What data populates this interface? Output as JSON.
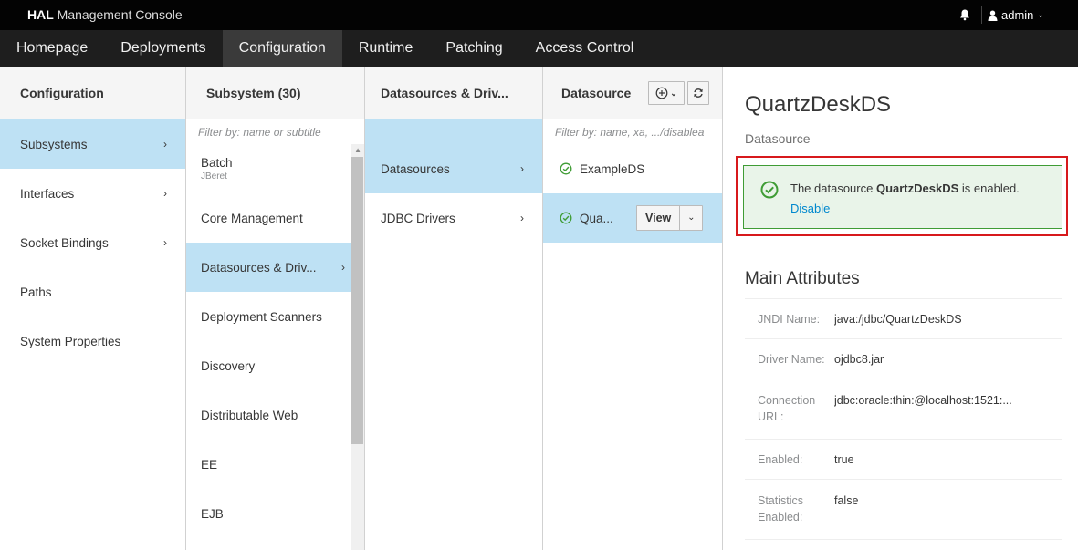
{
  "topbar": {
    "brand_bold": "HAL",
    "brand_rest": "Management Console",
    "user": "admin"
  },
  "nav": {
    "items": [
      "Homepage",
      "Deployments",
      "Configuration",
      "Runtime",
      "Patching",
      "Access Control"
    ],
    "active": "Configuration"
  },
  "columns": {
    "configuration": {
      "title": "Configuration",
      "items": [
        "Subsystems",
        "Interfaces",
        "Socket Bindings",
        "Paths",
        "System Properties"
      ]
    },
    "subsystem": {
      "title": "Subsystem (30)",
      "filter_placeholder": "Filter by: name or subtitle",
      "items": [
        {
          "label": "Batch",
          "sub": "JBeret"
        },
        {
          "label": "Core Management",
          "sub": ""
        },
        {
          "label": "Datasources & Driv...",
          "sub": ""
        },
        {
          "label": "Deployment Scanners",
          "sub": ""
        },
        {
          "label": "Discovery",
          "sub": ""
        },
        {
          "label": "Distributable Web",
          "sub": ""
        },
        {
          "label": "EE",
          "sub": ""
        },
        {
          "label": "EJB",
          "sub": ""
        }
      ]
    },
    "datasources_drivers": {
      "title": "Datasources & Driv...",
      "items": [
        "Datasources",
        "JDBC Drivers"
      ]
    },
    "datasource": {
      "title": "Datasource",
      "filter_placeholder": "Filter by: name, xa, .../disablea",
      "items": [
        "ExampleDS",
        "Qua..."
      ],
      "view_label": "View"
    }
  },
  "detail": {
    "title": "QuartzDeskDS",
    "subtitle": "Datasource",
    "alert_prefix": "The datasource",
    "alert_name": "QuartzDeskDS",
    "alert_suffix": "is enabled.",
    "alert_link": "Disable",
    "section_title": "Main Attributes",
    "attributes": [
      {
        "key": "JNDI Name:",
        "key2": "",
        "value": "java:/jdbc/QuartzDeskDS"
      },
      {
        "key": "Driver Name:",
        "key2": "",
        "value": "ojdbc8.jar"
      },
      {
        "key": "Connection",
        "key2": "URL:",
        "value": "jdbc:oracle:thin:@localhost:1521:..."
      },
      {
        "key": "Enabled:",
        "key2": "",
        "value": "true"
      },
      {
        "key": "Statistics",
        "key2": "Enabled:",
        "value": "false"
      }
    ]
  },
  "colors": {
    "topbar": "#030303",
    "navbar": "#1e1e1e",
    "selected": "#bee1f4",
    "success": "#3f9c35",
    "link": "#0088ce",
    "highlight": "#d7191c"
  }
}
